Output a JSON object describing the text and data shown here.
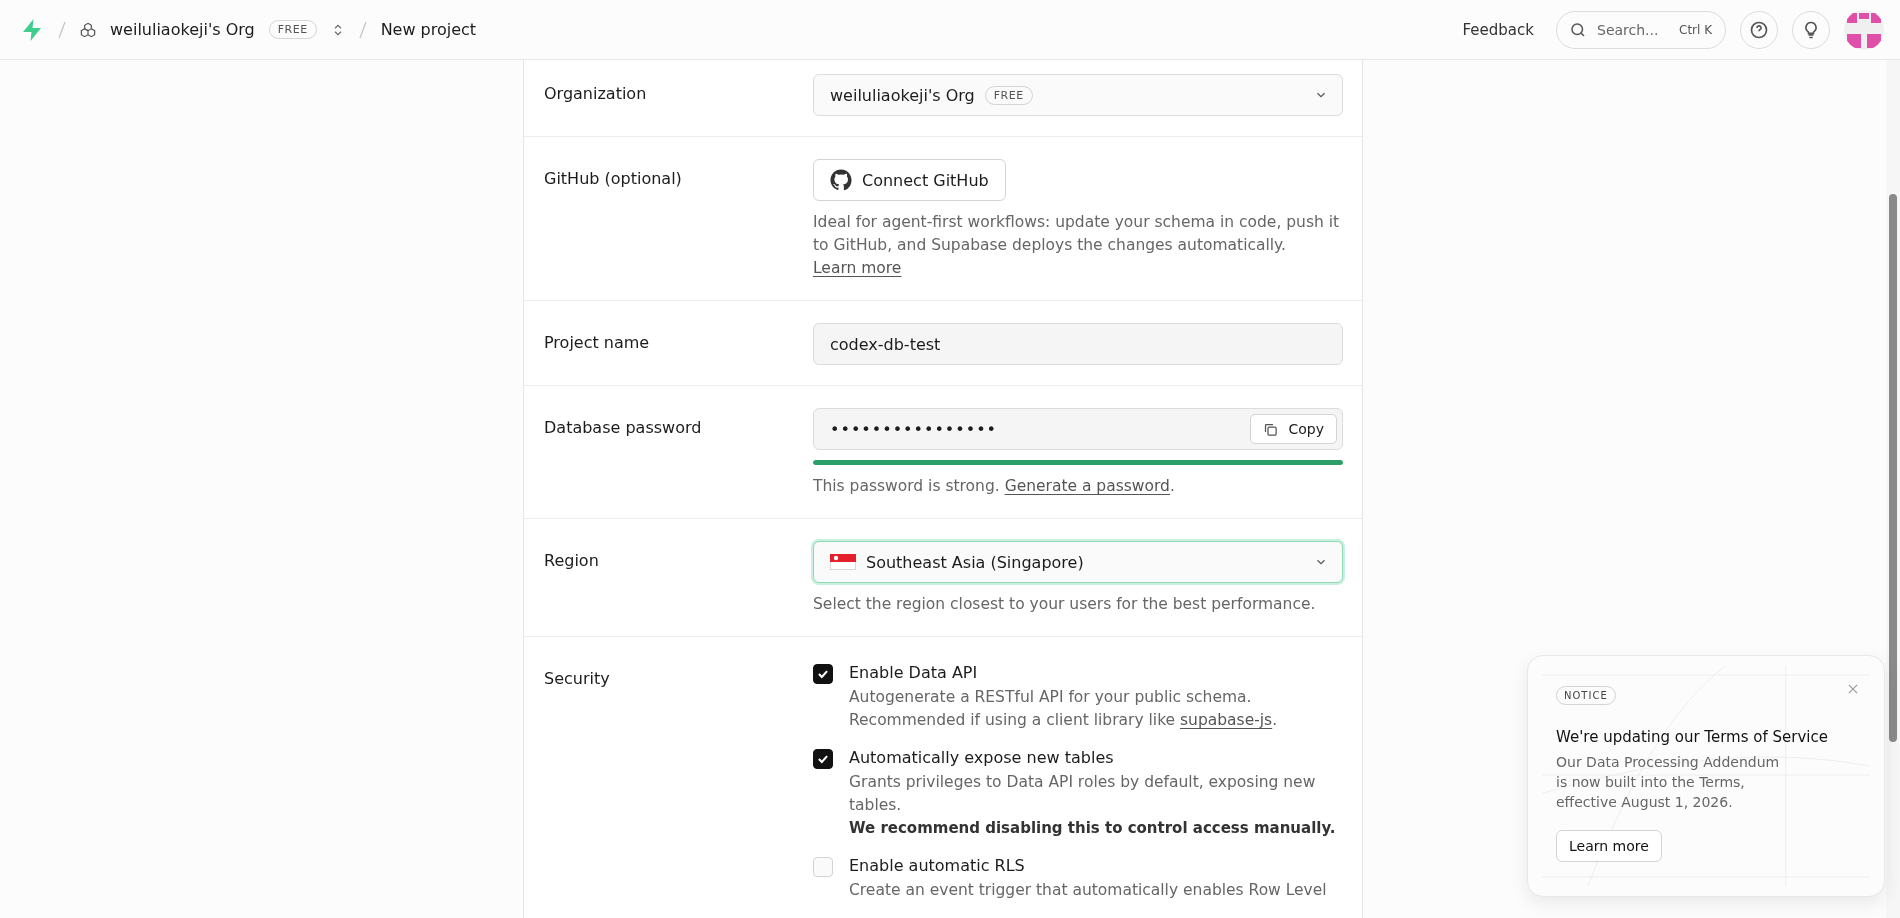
{
  "topbar": {
    "org": "weiluliaokeji's Org",
    "org_badge": "FREE",
    "page": "New project",
    "feedback": "Feedback",
    "search": {
      "placeholder": "Search...",
      "shortcut": "Ctrl K"
    }
  },
  "form": {
    "rows": [
      {
        "kind": "select",
        "label": "Organization",
        "value": "weiluliaokeji's Org",
        "badge": "FREE"
      },
      {
        "kind": "github",
        "label": "GitHub (optional)",
        "button": "Connect GitHub",
        "help": "Ideal for agent-first workflows: update your schema in code, push it to GitHub, and Supabase deploys the changes automatically.",
        "link": "Learn more"
      },
      {
        "kind": "text",
        "label": "Project name",
        "value": "codex-db-test"
      },
      {
        "kind": "password",
        "label": "Database password",
        "value": "••••••••••••••••",
        "copy": "Copy",
        "level": 1,
        "help": "This password is strong.",
        "link": "Generate a password",
        "after": "."
      },
      {
        "kind": "region",
        "label": "Region",
        "value": "Southeast Asia (Singapore)",
        "focused": true,
        "help": "Select the region closest to your users for the best performance."
      },
      {
        "kind": "checks",
        "label": "Security",
        "options": [
          {
            "title": "Enable Data API",
            "checked": true,
            "description": "Autogenerate a RESTful API for your public schema. Recommended if using a client library like",
            "link": "supabase-js",
            "after": "."
          },
          {
            "title": "Automatically expose new tables",
            "checked": true,
            "description": "Grants privileges to Data API roles by default, exposing new tables.",
            "warning": "We recommend disabling this to control access manually."
          },
          {
            "title": "Enable automatic RLS",
            "checked": false,
            "description": "Create an event trigger that automatically enables Row Level"
          }
        ]
      }
    ]
  },
  "notice": {
    "badge": "NOTICE",
    "title": "We're updating our Terms of Service",
    "body": "Our Data Processing Addendum is now built into the Terms, effective August 1, 2026.",
    "button": "Learn more"
  }
}
